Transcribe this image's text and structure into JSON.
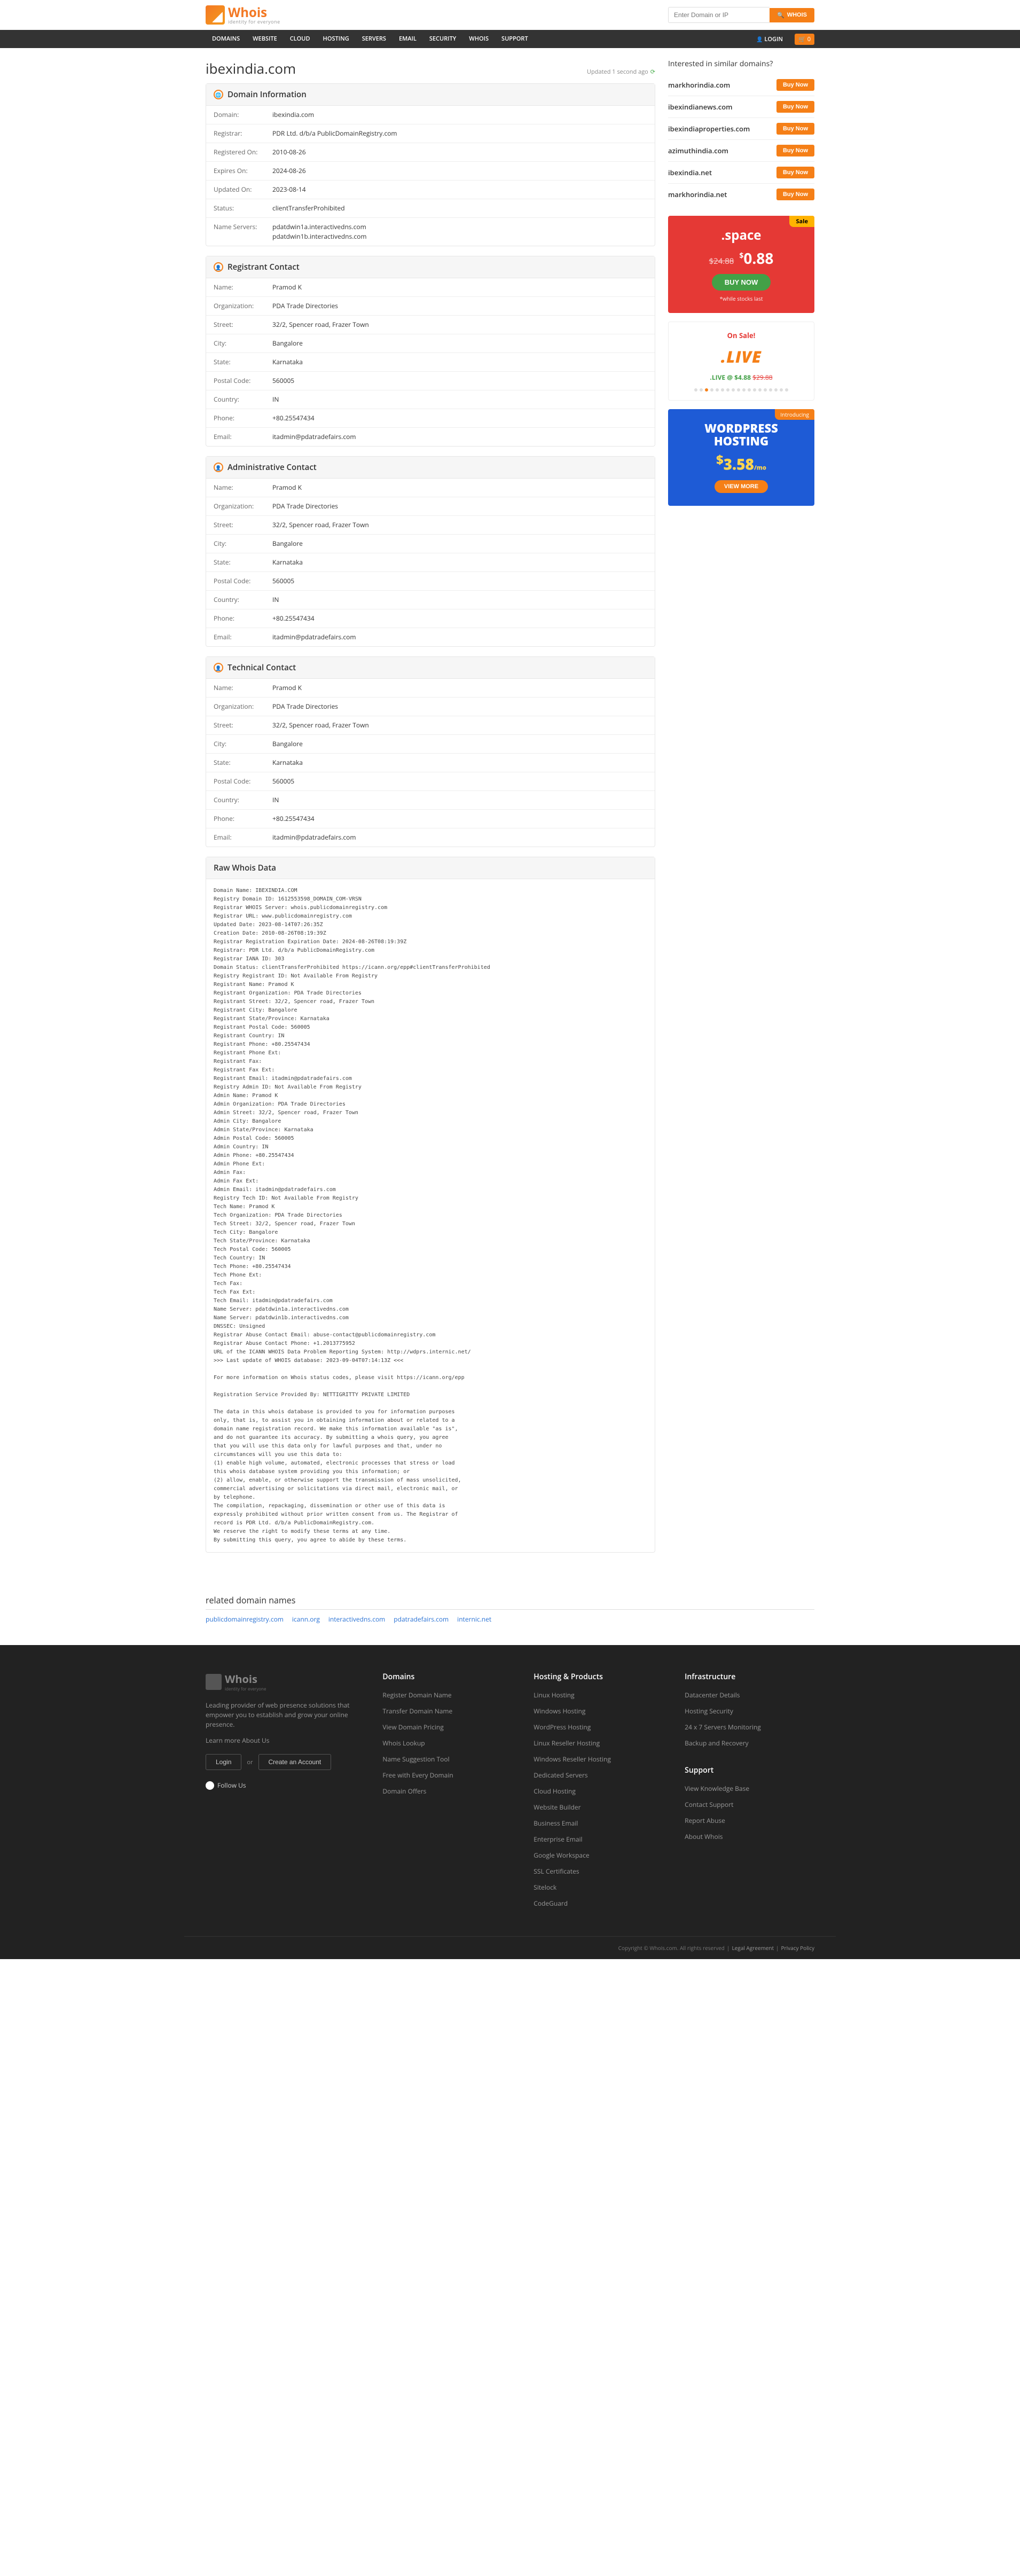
{
  "brand": {
    "name": "Whois",
    "tagline": "identity for everyone"
  },
  "search": {
    "placeholder": "Enter Domain or IP",
    "button": "WHOIS"
  },
  "nav": {
    "items": [
      "DOMAINS",
      "WEBSITE",
      "CLOUD",
      "HOSTING",
      "SERVERS",
      "EMAIL",
      "SECURITY",
      "WHOIS",
      "SUPPORT"
    ],
    "login": "LOGIN",
    "cartCount": "0"
  },
  "domain": "ibexindia.com",
  "updated": "Updated 1 second ago",
  "panels": {
    "info": {
      "title": "Domain Information",
      "rows": [
        [
          "Domain:",
          "ibexindia.com"
        ],
        [
          "Registrar:",
          "PDR Ltd. d/b/a PublicDomainRegistry.com"
        ],
        [
          "Registered On:",
          "2010-08-26"
        ],
        [
          "Expires On:",
          "2024-08-26"
        ],
        [
          "Updated On:",
          "2023-08-14"
        ],
        [
          "Status:",
          "clientTransferProhibited"
        ],
        [
          "Name Servers:",
          "pdatdwin1a.interactivedns.com\npdatdwin1b.interactivedns.com"
        ]
      ]
    },
    "registrant": {
      "title": "Registrant Contact",
      "rows": [
        [
          "Name:",
          "Pramod K"
        ],
        [
          "Organization:",
          "PDA Trade Directories"
        ],
        [
          "Street:",
          "32/2, Spencer road, Frazer Town"
        ],
        [
          "City:",
          "Bangalore"
        ],
        [
          "State:",
          "Karnataka"
        ],
        [
          "Postal Code:",
          "560005"
        ],
        [
          "Country:",
          "IN"
        ],
        [
          "Phone:",
          "+80.25547434"
        ],
        [
          "Email:",
          "itadmin@pdatradefairs.com"
        ]
      ]
    },
    "admin": {
      "title": "Administrative Contact",
      "rows": [
        [
          "Name:",
          "Pramod K"
        ],
        [
          "Organization:",
          "PDA Trade Directories"
        ],
        [
          "Street:",
          "32/2, Spencer road, Frazer Town"
        ],
        [
          "City:",
          "Bangalore"
        ],
        [
          "State:",
          "Karnataka"
        ],
        [
          "Postal Code:",
          "560005"
        ],
        [
          "Country:",
          "IN"
        ],
        [
          "Phone:",
          "+80.25547434"
        ],
        [
          "Email:",
          "itadmin@pdatradefairs.com"
        ]
      ]
    },
    "tech": {
      "title": "Technical Contact",
      "rows": [
        [
          "Name:",
          "Pramod K"
        ],
        [
          "Organization:",
          "PDA Trade Directories"
        ],
        [
          "Street:",
          "32/2, Spencer road, Frazer Town"
        ],
        [
          "City:",
          "Bangalore"
        ],
        [
          "State:",
          "Karnataka"
        ],
        [
          "Postal Code:",
          "560005"
        ],
        [
          "Country:",
          "IN"
        ],
        [
          "Phone:",
          "+80.25547434"
        ],
        [
          "Email:",
          "itadmin@pdatradefairs.com"
        ]
      ]
    }
  },
  "rawTitle": "Raw Whois Data",
  "raw": "Domain Name: IBEXINDIA.COM\nRegistry Domain ID: 1612553598_DOMAIN_COM-VRSN\nRegistrar WHOIS Server: whois.publicdomainregistry.com\nRegistrar URL: www.publicdomainregistry.com\nUpdated Date: 2023-08-14T07:26:35Z\nCreation Date: 2010-08-26T08:19:39Z\nRegistrar Registration Expiration Date: 2024-08-26T08:19:39Z\nRegistrar: PDR Ltd. d/b/a PublicDomainRegistry.com\nRegistrar IANA ID: 303\nDomain Status: clientTransferProhibited https://icann.org/epp#clientTransferProhibited\nRegistry Registrant ID: Not Available From Registry\nRegistrant Name: Pramod K\nRegistrant Organization: PDA Trade Directories\nRegistrant Street: 32/2, Spencer road, Frazer Town\nRegistrant City: Bangalore\nRegistrant State/Province: Karnataka\nRegistrant Postal Code: 560005\nRegistrant Country: IN\nRegistrant Phone: +80.25547434\nRegistrant Phone Ext:\nRegistrant Fax:\nRegistrant Fax Ext:\nRegistrant Email: itadmin@pdatradefairs.com\nRegistry Admin ID: Not Available From Registry\nAdmin Name: Pramod K\nAdmin Organization: PDA Trade Directories\nAdmin Street: 32/2, Spencer road, Frazer Town\nAdmin City: Bangalore\nAdmin State/Province: Karnataka\nAdmin Postal Code: 560005\nAdmin Country: IN\nAdmin Phone: +80.25547434\nAdmin Phone Ext:\nAdmin Fax:\nAdmin Fax Ext:\nAdmin Email: itadmin@pdatradefairs.com\nRegistry Tech ID: Not Available From Registry\nTech Name: Pramod K\nTech Organization: PDA Trade Directories\nTech Street: 32/2, Spencer road, Frazer Town\nTech City: Bangalore\nTech State/Province: Karnataka\nTech Postal Code: 560005\nTech Country: IN\nTech Phone: +80.25547434\nTech Phone Ext:\nTech Fax:\nTech Fax Ext:\nTech Email: itadmin@pdatradefairs.com\nName Server: pdatdwin1a.interactivedns.com\nName Server: pdatdwin1b.interactivedns.com\nDNSSEC: Unsigned\nRegistrar Abuse Contact Email: abuse-contact@publicdomainregistry.com\nRegistrar Abuse Contact Phone: +1.2013775952\nURL of the ICANN WHOIS Data Problem Reporting System: http://wdprs.internic.net/\n>>> Last update of WHOIS database: 2023-09-04T07:14:13Z <<<\n\nFor more information on Whois status codes, please visit https://icann.org/epp\n\nRegistration Service Provided By: NETTIGRITTY PRIVATE LIMITED\n\nThe data in this whois database is provided to you for information purposes\nonly, that is, to assist you in obtaining information about or related to a\ndomain name registration record. We make this information available \"as is\",\nand do not guarantee its accuracy. By submitting a whois query, you agree\nthat you will use this data only for lawful purposes and that, under no\ncircumstances will you use this data to:\n(1) enable high volume, automated, electronic processes that stress or load\nthis whois database system providing you this information; or\n(2) allow, enable, or otherwise support the transmission of mass unsolicited,\ncommercial advertising or solicitations via direct mail, electronic mail, or\nby telephone.\nThe compilation, repackaging, dissemination or other use of this data is\nexpressly prohibited without prior written consent from us. The Registrar of\nrecord is PDR Ltd. d/b/a PublicDomainRegistry.com.\nWe reserve the right to modify these terms at any time.\nBy submitting this query, you agree to abide by these terms.",
  "similar": {
    "title": "Interested in similar domains?",
    "btn": "Buy Now",
    "items": [
      "markhorindia.com",
      "ibexindianews.com",
      "ibexindiaproperties.com",
      "azimuthindia.com",
      "ibexindia.net",
      "markhorindia.net"
    ]
  },
  "promo1": {
    "badge": "Sale",
    "tld": ".space",
    "old": "$24.88",
    "new": "0.88",
    "currency": "$",
    "btn": "BUY NOW",
    "stock": "*while stocks last"
  },
  "promo2": {
    "onsale": "On Sale!",
    "big": ".LIVE",
    "at": ".LIVE @ $4.88",
    "strike": "$29.88"
  },
  "promo3": {
    "intro": "Introducing",
    "l1": "WORDPRESS",
    "l2": "HOSTING",
    "price": "3.58",
    "currency": "$",
    "per": "/mo",
    "btn": "VIEW MORE"
  },
  "related": {
    "title": "related domain names",
    "items": [
      "publicdomainregistry.com",
      "icann.org",
      "interactivedns.com",
      "pdatradefairs.com",
      "internic.net"
    ]
  },
  "footer": {
    "blurb": "Leading provider of web presence solutions that empower you to establish and grow your online presence.",
    "learn": "Learn more About Us",
    "login": "Login",
    "or": "or",
    "create": "Create an Account",
    "follow": "Follow Us",
    "cols": [
      {
        "title": "Domains",
        "links": [
          "Register Domain Name",
          "Transfer Domain Name",
          "View Domain Pricing",
          "Whois Lookup",
          "Name Suggestion Tool",
          "Free with Every Domain",
          "Domain Offers"
        ]
      },
      {
        "title": "Hosting & Products",
        "links": [
          "Linux Hosting",
          "Windows Hosting",
          "WordPress Hosting",
          "Linux Reseller Hosting",
          "Windows Reseller Hosting",
          "Dedicated Servers",
          "Cloud Hosting",
          "Website Builder",
          "Business Email",
          "Enterprise Email",
          "Google Workspace",
          "SSL Certificates",
          "Sitelock",
          "CodeGuard"
        ]
      },
      {
        "title": "Infrastructure",
        "links": [
          "Datacenter Details",
          "Hosting Security",
          "24 x 7 Servers Monitoring",
          "Backup and Recovery"
        ]
      },
      {
        "title": "Support",
        "links": [
          "View Knowledge Base",
          "Contact Support",
          "Report Abuse",
          "About Whois"
        ]
      }
    ],
    "copyright": "Copyright © Whois.com. All rights reserved",
    "legal": "Legal Agreement",
    "privacy": "Privacy Policy"
  }
}
